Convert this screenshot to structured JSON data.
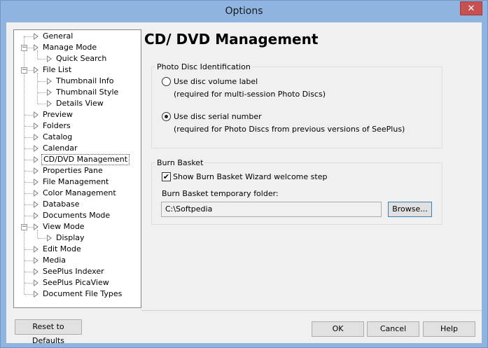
{
  "window": {
    "title": "Options",
    "close_glyph": "✕"
  },
  "tree": {
    "items": [
      {
        "label": "General"
      },
      {
        "label": "Manage Mode"
      },
      {
        "label": "Quick Search"
      },
      {
        "label": "File List"
      },
      {
        "label": "Thumbnail Info"
      },
      {
        "label": "Thumbnail Style"
      },
      {
        "label": "Details View"
      },
      {
        "label": "Preview"
      },
      {
        "label": "Folders"
      },
      {
        "label": "Catalog"
      },
      {
        "label": "Calendar"
      },
      {
        "label": "CD/DVD Management",
        "selected": true
      },
      {
        "label": "Properties Pane"
      },
      {
        "label": "File Management"
      },
      {
        "label": "Color Management"
      },
      {
        "label": "Database"
      },
      {
        "label": "Documents Mode"
      },
      {
        "label": "View Mode"
      },
      {
        "label": "Display"
      },
      {
        "label": "Edit Mode"
      },
      {
        "label": "Media"
      },
      {
        "label": "SeePlus Indexer"
      },
      {
        "label": "SeePlus PicaView"
      },
      {
        "label": "Document File Types"
      }
    ],
    "expander_glyph": "−"
  },
  "page": {
    "heading": "CD/ DVD Management",
    "photo_disc": {
      "title": "Photo Disc Identification",
      "opt1_label": "Use disc volume label",
      "opt1_note": "(required for multi-session Photo Discs)",
      "opt2_label": "Use disc serial number",
      "opt2_note": "(required for Photo Discs from previous versions of SeePlus)",
      "selected": "Use disc serial number"
    },
    "burn_basket": {
      "title": "Burn Basket",
      "wizard_label": "Show Burn Basket Wizard welcome step",
      "wizard_checked": true,
      "check_glyph": "✔",
      "folder_label": "Burn Basket temporary folder:",
      "folder_value": "C:\\Softpedia",
      "browse_label": "Browse..."
    }
  },
  "buttons": {
    "reset": "Reset to Defaults",
    "ok": "OK",
    "cancel": "Cancel",
    "help": "Help"
  }
}
